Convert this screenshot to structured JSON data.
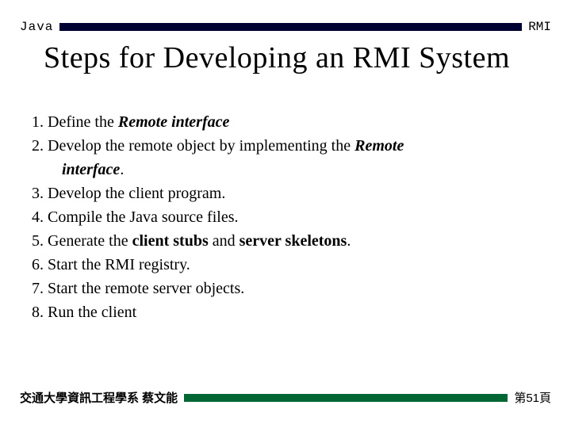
{
  "header": {
    "left": "Java",
    "right": "RMI"
  },
  "title": "Steps for Developing an RMI System",
  "steps": {
    "n1": "1. Define the ",
    "n1b": "Remote interface",
    "n2": "2. Develop the remote object by implementing the ",
    "n2b": "Remote",
    "n2c": "interface",
    "n2d": ".",
    "n3": "3. Develop the client program.",
    "n4": "4. Compile the Java source files.",
    "n5a": "5. Generate the ",
    "n5b": "client stubs",
    "n5c": " and ",
    "n5d": "server skeletons",
    "n5e": ".",
    "n6": "6. Start the RMI registry.",
    "n7": "7. Start the remote server objects.",
    "n8": "8. Run the client"
  },
  "footer": {
    "left": "交通大學資訊工程學系 蔡文能",
    "right": "第51頁"
  }
}
